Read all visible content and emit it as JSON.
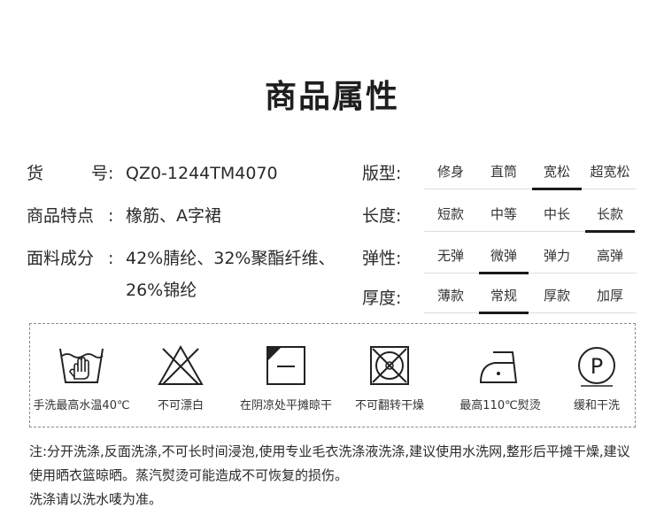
{
  "title": "商品属性",
  "specs": {
    "item_no": {
      "label_chars": [
        "货",
        "号"
      ],
      "colon": ":",
      "value": "QZ0-1244TM4070"
    },
    "features": {
      "label": "商品特点",
      "colon": ":",
      "value": "橡筋、A字裙"
    },
    "material": {
      "label": "面料成分",
      "colon": ":",
      "value": "42%腈纶、32%聚酯纤维、26%锦纶"
    }
  },
  "attributes": [
    {
      "label": "版型:",
      "options": [
        "修身",
        "直筒",
        "宽松",
        "超宽松"
      ],
      "selected": "宽松"
    },
    {
      "label": "长度:",
      "options": [
        "短款",
        "中等",
        "中长",
        "长款"
      ],
      "selected": "长款"
    },
    {
      "label": "弹性:",
      "options": [
        "无弹",
        "微弹",
        "弹力",
        "高弹"
      ],
      "selected": "微弹"
    },
    {
      "label": "厚度:",
      "options": [
        "薄款",
        "常规",
        "厚款",
        "加厚"
      ],
      "selected": "常规"
    }
  ],
  "care": [
    {
      "icon": "hand-wash-icon",
      "label": "手洗最高水温40℃"
    },
    {
      "icon": "no-bleach-icon",
      "label": "不可漂白"
    },
    {
      "icon": "line-dry-flat-shade-icon",
      "label": "在阴凉处平摊晾干"
    },
    {
      "icon": "no-tumble-dry-icon",
      "label": "不可翻转干燥"
    },
    {
      "icon": "iron-icon",
      "label": "最高110℃熨烫"
    },
    {
      "icon": "dry-clean-p-icon",
      "label": "缓和干洗",
      "symbol_letter": "P"
    }
  ],
  "notes": {
    "line1": "注:分开洗涤,反面洗涤,不可长时间浸泡,使用专业毛衣洗涤液洗涤,建议使用水洗网,整形后平摊干燥,建议使用晒衣篮晾晒。蒸汽熨烫可能造成不可恢复的损伤。",
    "line2": "洗涤请以洗水唛为准。"
  }
}
